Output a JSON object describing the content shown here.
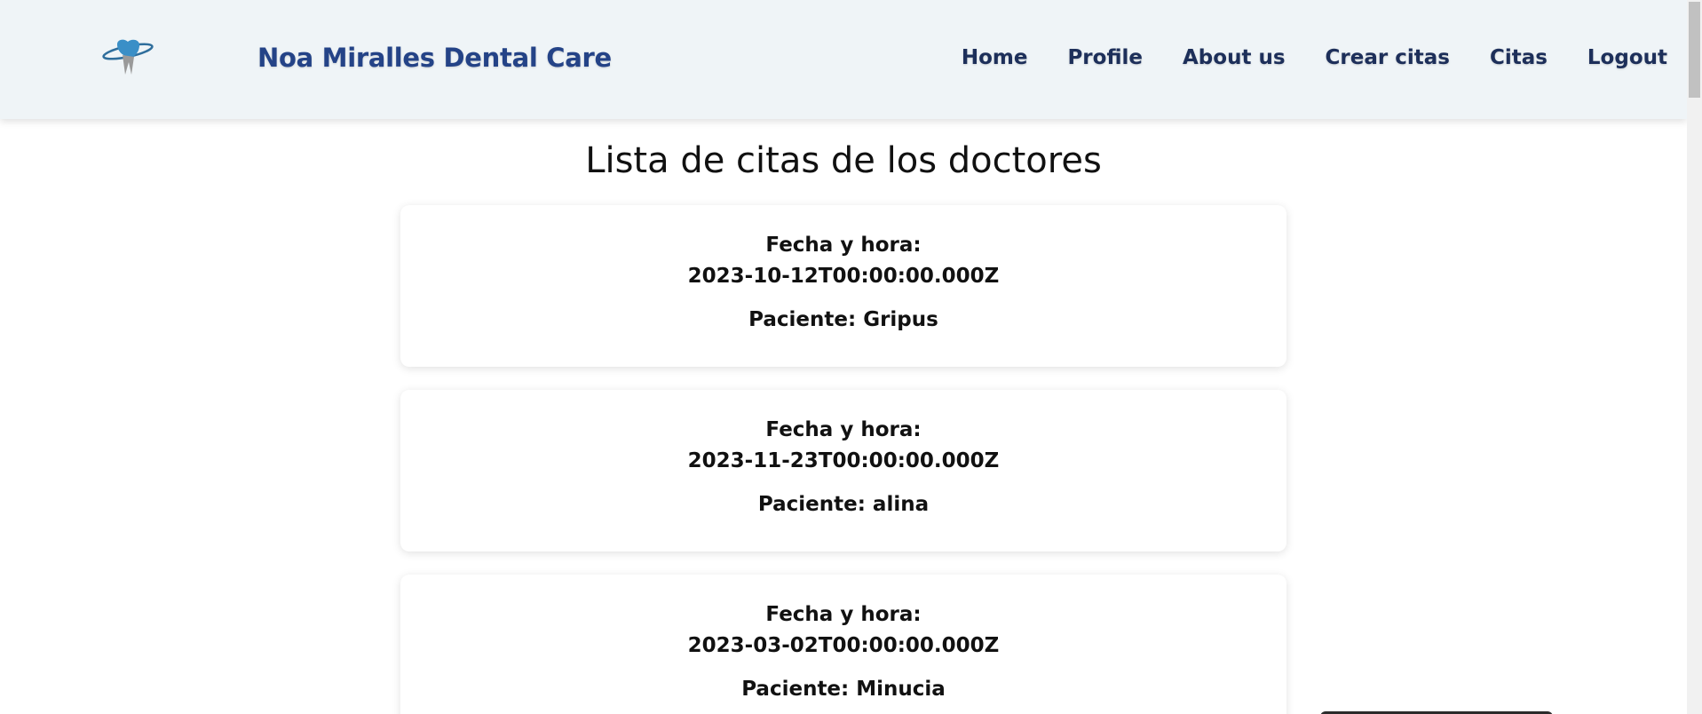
{
  "header": {
    "brand": "Noa Miralles Dental Care",
    "logo_icon": "tooth-logo-icon",
    "nav": [
      {
        "label": "Home"
      },
      {
        "label": "Profile"
      },
      {
        "label": "About us"
      },
      {
        "label": "Crear citas"
      },
      {
        "label": "Citas"
      },
      {
        "label": "Logout"
      }
    ]
  },
  "main": {
    "title": "Lista de citas de los doctores",
    "appointments": [
      {
        "date_label": "Fecha y hora:",
        "datetime": "2023-10-12T00:00:00.000Z",
        "patient": "Paciente: Gripus"
      },
      {
        "date_label": "Fecha y hora:",
        "datetime": "2023-11-23T00:00:00.000Z",
        "patient": "Paciente: alina"
      },
      {
        "date_label": "Fecha y hora:",
        "datetime": "2023-03-02T00:00:00.000Z",
        "patient": "Paciente: Minucia"
      }
    ]
  },
  "colors": {
    "header_bg": "#eff4f7",
    "brand": "#244387",
    "nav_text": "#1d2f5a",
    "logo_blue": "#3a8fc7",
    "logo_gray": "#9a9a9a"
  }
}
